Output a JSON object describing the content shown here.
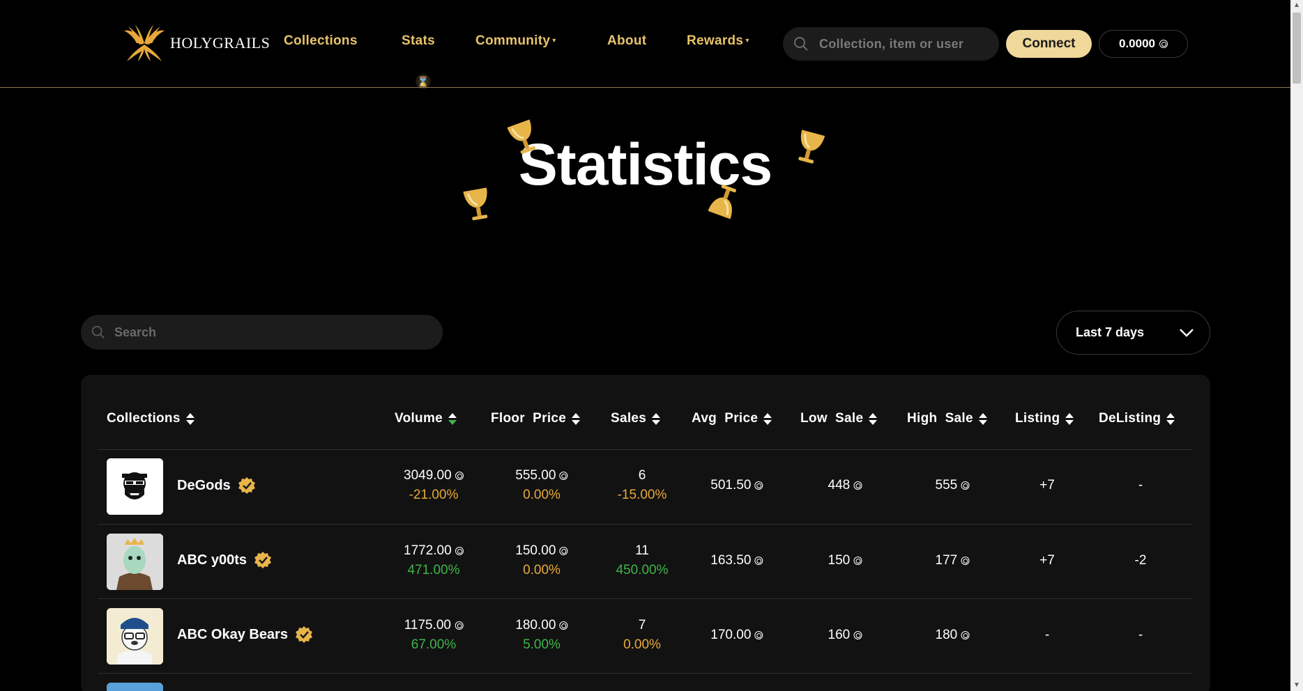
{
  "brand": {
    "name": "HOLYGRAILS"
  },
  "nav": {
    "collections": "Collections",
    "stats": "Stats",
    "community": "Community",
    "about": "About",
    "rewards": "Rewards"
  },
  "header": {
    "search_placeholder": "Collection, item or user",
    "connect_label": "Connect",
    "balance": "0.0000"
  },
  "hero": {
    "title": "Statistics"
  },
  "filters": {
    "search_placeholder": "Search",
    "period": "Last 7 days"
  },
  "table": {
    "headers": {
      "collections": "Collections",
      "volume": "Volume",
      "floor_price": "Floor  Price",
      "sales": "Sales",
      "avg_price": "Avg  Price",
      "low_sale": "Low  Sale",
      "high_sale": "High  Sale",
      "listing": "Listing",
      "delisting": "DeListing"
    },
    "rows": [
      {
        "name": "DeGods",
        "verified": true,
        "volume": "3049.00",
        "volume_change": "-21.00%",
        "floor": "555.00",
        "floor_change": "0.00%",
        "sales": "6",
        "sales_change": "-15.00%",
        "avg": "501.50",
        "low": "448",
        "high": "555",
        "listing": "+7",
        "delisting": "-"
      },
      {
        "name": "ABC y00ts",
        "verified": true,
        "volume": "1772.00",
        "volume_change": "471.00%",
        "floor": "150.00",
        "floor_change": "0.00%",
        "sales": "11",
        "sales_change": "450.00%",
        "avg": "163.50",
        "low": "150",
        "high": "177",
        "listing": "+7",
        "delisting": "-2"
      },
      {
        "name": "ABC Okay Bears",
        "verified": true,
        "volume": "1175.00",
        "volume_change": "67.00%",
        "floor": "180.00",
        "floor_change": "5.00%",
        "sales": "7",
        "sales_change": "0.00%",
        "avg": "170.00",
        "low": "160",
        "high": "180",
        "listing": "-",
        "delisting": "-"
      }
    ]
  },
  "colors": {
    "accent": "#e8c36b",
    "positive": "#3fb54a",
    "negative": "#e8a93a",
    "connect_bg": "#efd89a"
  }
}
